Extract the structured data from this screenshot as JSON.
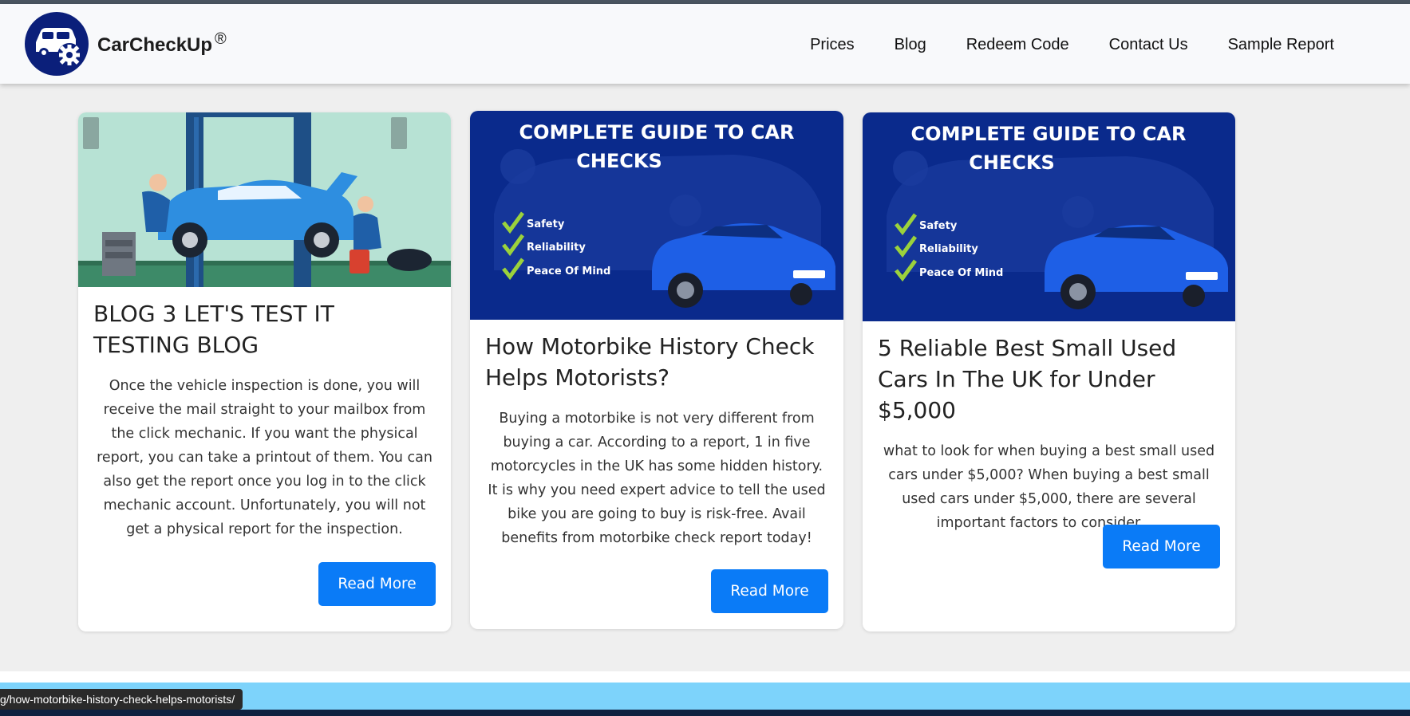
{
  "brand": {
    "name": "CarCheckUp",
    "mark": "®"
  },
  "nav": [
    "Prices",
    "Blog",
    "Redeem Code",
    "Contact Us",
    "Sample Report"
  ],
  "banner": {
    "heading_line1": "COMPLETE GUIDE TO CAR",
    "heading_line2": "CHECKS",
    "checks": [
      "Safety",
      "Reliability",
      "Peace Of Mind"
    ]
  },
  "cards": [
    {
      "title": "BLOG 3 LET'S TEST IT TESTING BLOG",
      "excerpt": "Once the vehicle inspection is done, you will receive the mail straight to your mailbox from the click mechanic. If you want the physical report, you can take a printout of them. You can also get the report once you log in to the click mechanic account. Unfortunately, you will not get a physical report for the inspection.",
      "button": "Read More"
    },
    {
      "title": "How Motorbike History Check Helps Motorists?",
      "excerpt": "Buying a motorbike is not very different from buying a car. According to a report, 1 in five motorcycles in the UK has some hidden history. It is why you need expert advice to tell the used bike you are going to buy is risk-free. Avail benefits from motorbike check report today!",
      "button": "Read More"
    },
    {
      "title": "5 Reliable Best Small Used Cars In The UK for Under $5,000",
      "excerpt": "what to look for when buying a best small used cars under $5,000? When buying a best small used cars under $5,000, there are several important factors to consider.....",
      "button": "Read More"
    }
  ],
  "status_url": "g/how-motorbike-history-check-helps-motorists/",
  "colors": {
    "accent": "#0a7bf7",
    "banner_bg": "#0a2a8c",
    "logo_bg": "#0b1f7a",
    "footer": "#7dd3fb"
  }
}
